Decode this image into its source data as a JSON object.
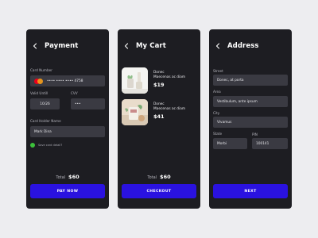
{
  "colors": {
    "background": "#ededf0",
    "screen": "#1d1d22",
    "field": "#3a3a42",
    "accent": "#2a12e0",
    "toggle": "#3cc13b"
  },
  "payment": {
    "title": "Payment",
    "card_number_label": "Card Number",
    "card_number_value": "•••• •••• •••• 4758",
    "card_icon": "mastercard-icon",
    "valid_until_label": "Valid Untill",
    "valid_until_value": "10/26",
    "cvv_label": "CVV",
    "cvv_value": "•••",
    "holder_label": "Card Holder Name",
    "holder_value": "Mark Dina",
    "save_label": "Save card detail?",
    "total_label": "Total",
    "total_value": "$60",
    "button_label": "PAY NOW"
  },
  "cart": {
    "title": "My Cart",
    "items": [
      {
        "name_line1": "Donec",
        "name_line2": "Maecenas ac diam",
        "price": "$19"
      },
      {
        "name_line1": "Donec",
        "name_line2": "Maecenas ac diam",
        "price": "$41"
      }
    ],
    "total_label": "Total",
    "total_value": "$60",
    "button_label": "CHECKOUT"
  },
  "address": {
    "title": "Address",
    "street_label": "Street",
    "street_value": "Donec, at porta",
    "area_label": "Area",
    "area_value": "Vestibulum, ante ipsum",
    "city_label": "City",
    "city_value": "Vivamus",
    "state_label": "State",
    "state_value": "Morbi",
    "pin_label": "PIN",
    "pin_value": "100141",
    "button_label": "NEXT"
  }
}
